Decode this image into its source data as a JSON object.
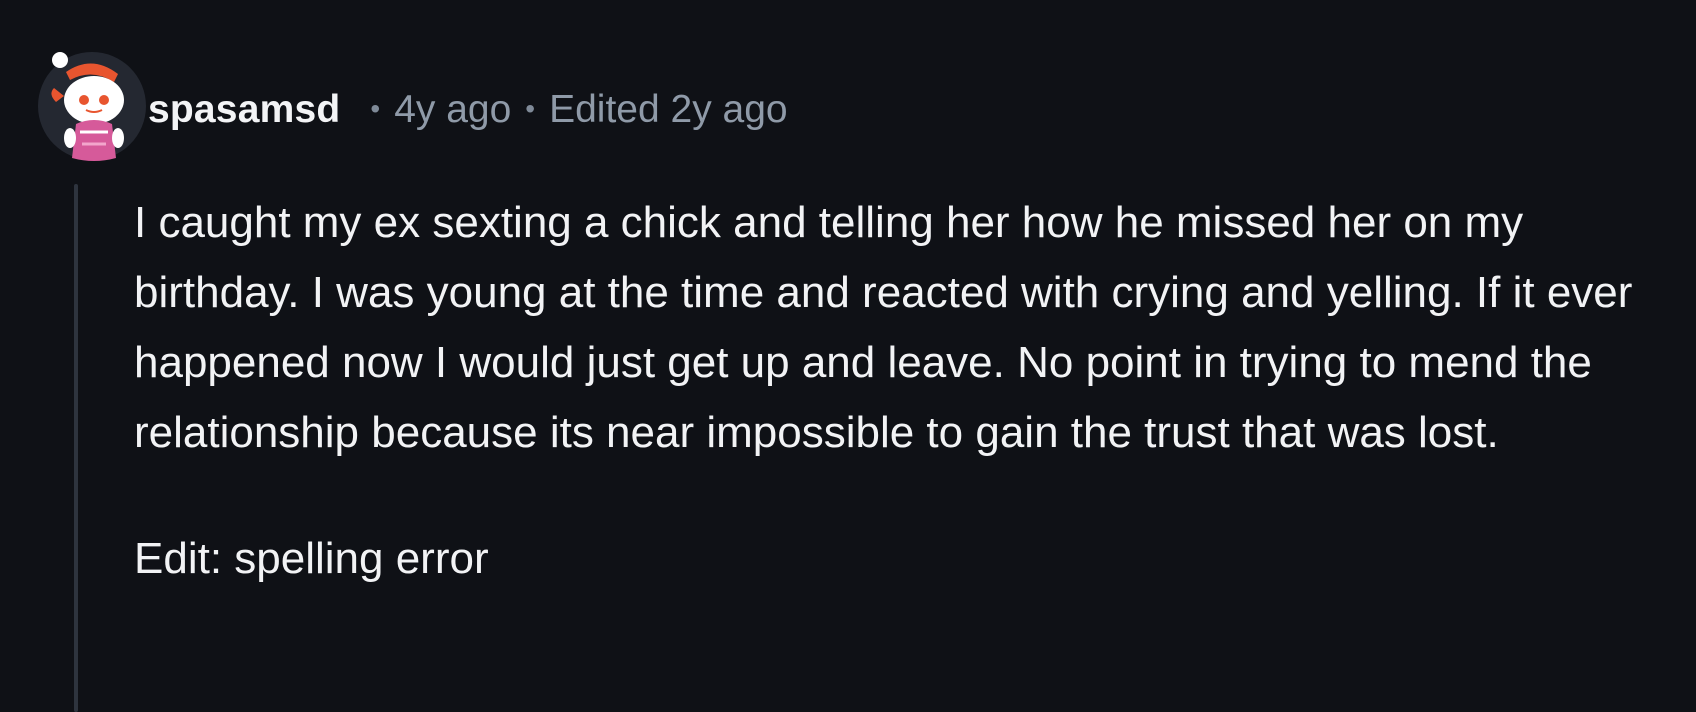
{
  "comment": {
    "avatar_icon": "reddit-snoo-avatar-icon",
    "username": "spasamsd",
    "separator": "•",
    "age": "4y ago",
    "edited": "Edited 2y ago",
    "body": "I caught my ex sexting a chick and telling her how he missed her on my birthday. I was young at the time and reacted with crying and yelling. If it ever happened now I would just get up and leave. No point in trying to mend the relationship because its near impossible to gain the trust that was lost.",
    "edit_note": "Edit: spelling error"
  },
  "colors": {
    "background": "#0f1116",
    "text": "#f2f3f5",
    "meta": "#8f9aa8",
    "thread_line": "#2e343e"
  }
}
